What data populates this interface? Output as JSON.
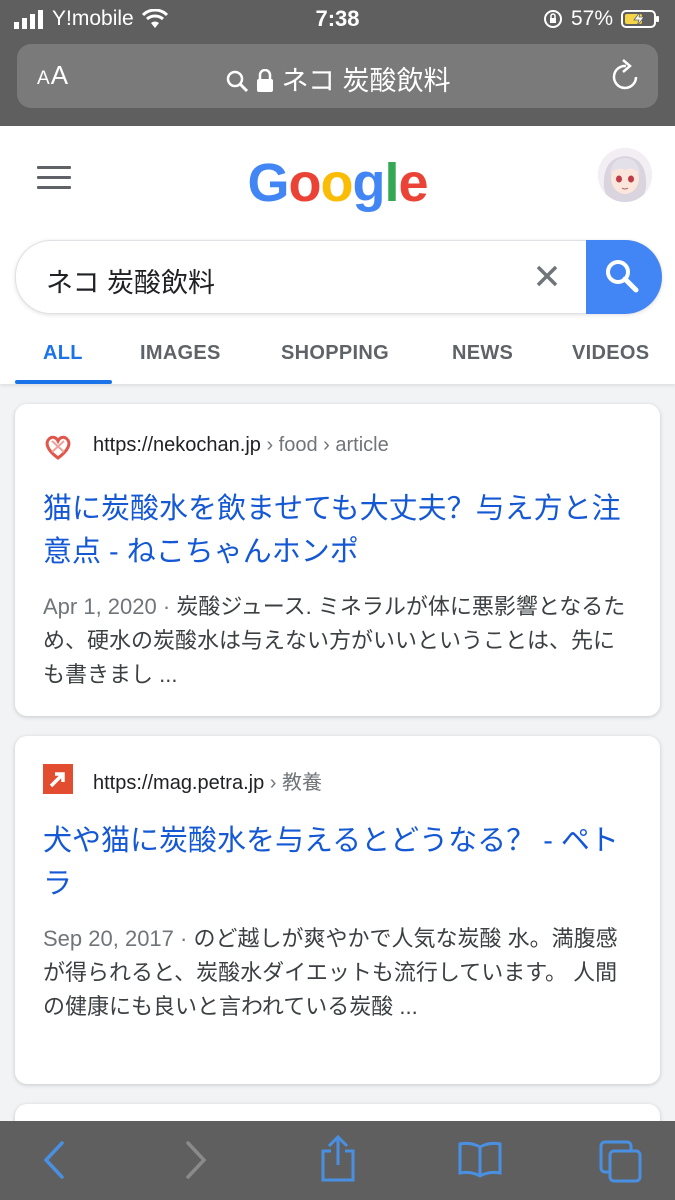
{
  "status": {
    "carrier": "Y!mobile",
    "time": "7:38",
    "battery": "57%"
  },
  "browser": {
    "text_size_label": "AA",
    "url_text": "ネコ 炭酸飲料"
  },
  "google": {
    "logo": "Google",
    "query": "ネコ 炭酸飲料",
    "tabs": [
      "ALL",
      "IMAGES",
      "SHOPPING",
      "NEWS",
      "VIDEOS"
    ],
    "active_tab": "ALL"
  },
  "results": [
    {
      "site": "https://nekochan.jp",
      "crumbs": "› food › article",
      "title": "猫に炭酸水を飲ませても大丈夫？与え方と注意点 - ねこちゃんホンポ",
      "date": "Apr 1, 2020 · ",
      "snippet": "炭酸ジュース. ミネラルが体に悪影響となるため、硬水の炭酸水は与えない方がいいということは、先にも書きまし ..."
    },
    {
      "site": "https://mag.petra.jp",
      "crumbs": "› 教養",
      "title": "犬や猫に炭酸水を与えるとどうなる？ - ペトラ",
      "date": "Sep 20, 2017 · ",
      "snippet": "のど越しが爽やかで人気な炭酸 水。満腹感が得られると、炭酸水ダイエットも流行しています。 人間の健康にも良いと言われている炭酸 ..."
    }
  ],
  "colors": {
    "accent": "#1a73e8",
    "link": "#1558d6",
    "search_button": "#4285f4",
    "chrome": "#5f5f5f"
  }
}
